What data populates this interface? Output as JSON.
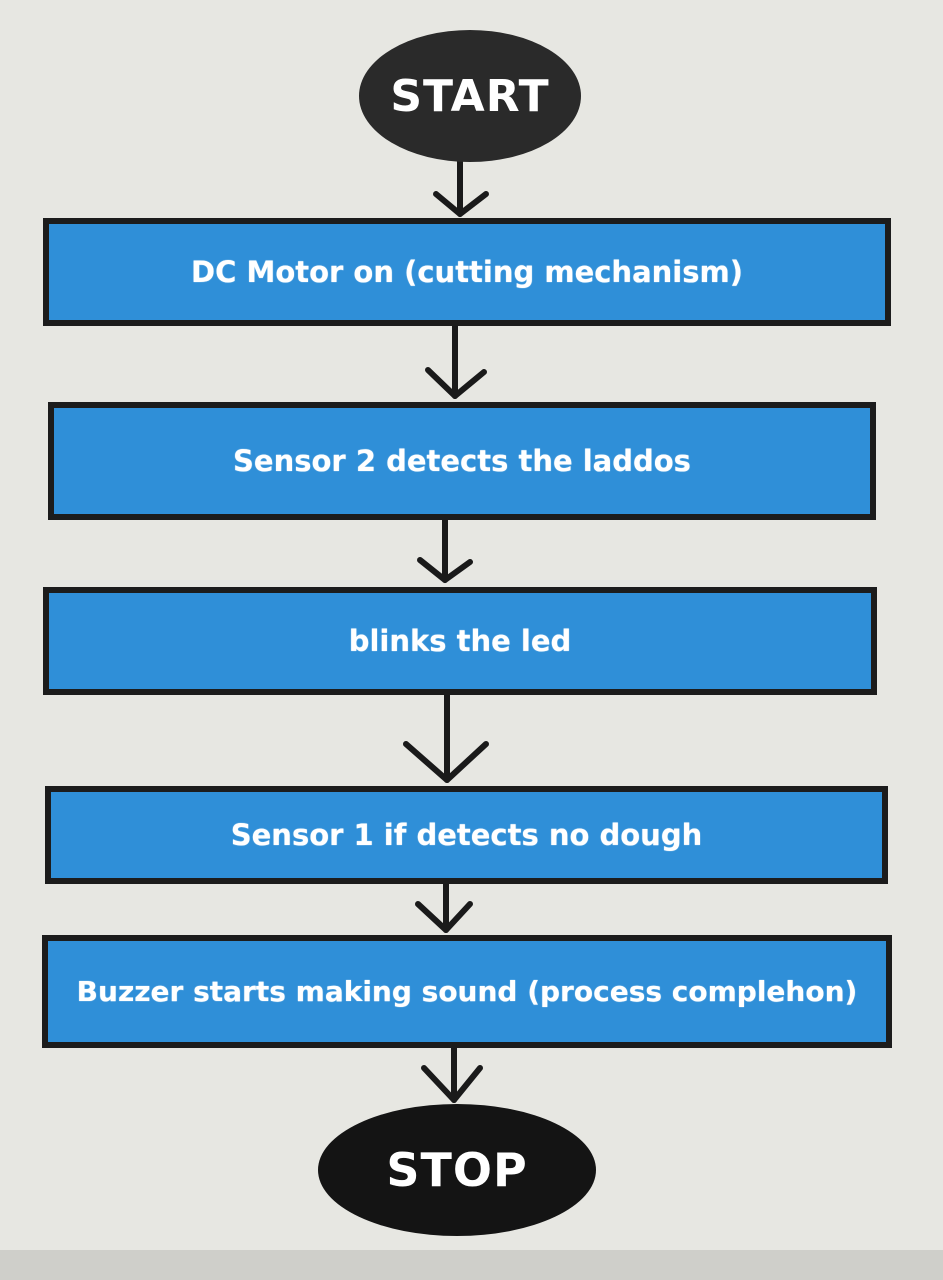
{
  "flowchart": {
    "start_label": "START",
    "stop_label": "STOP",
    "steps": [
      "DC Motor on (cutting mechanism)",
      "Sensor 2 detects the laddos",
      "blinks the led",
      "Sensor 1 if detects no dough",
      "Buzzer starts making sound (process complehon)"
    ]
  }
}
